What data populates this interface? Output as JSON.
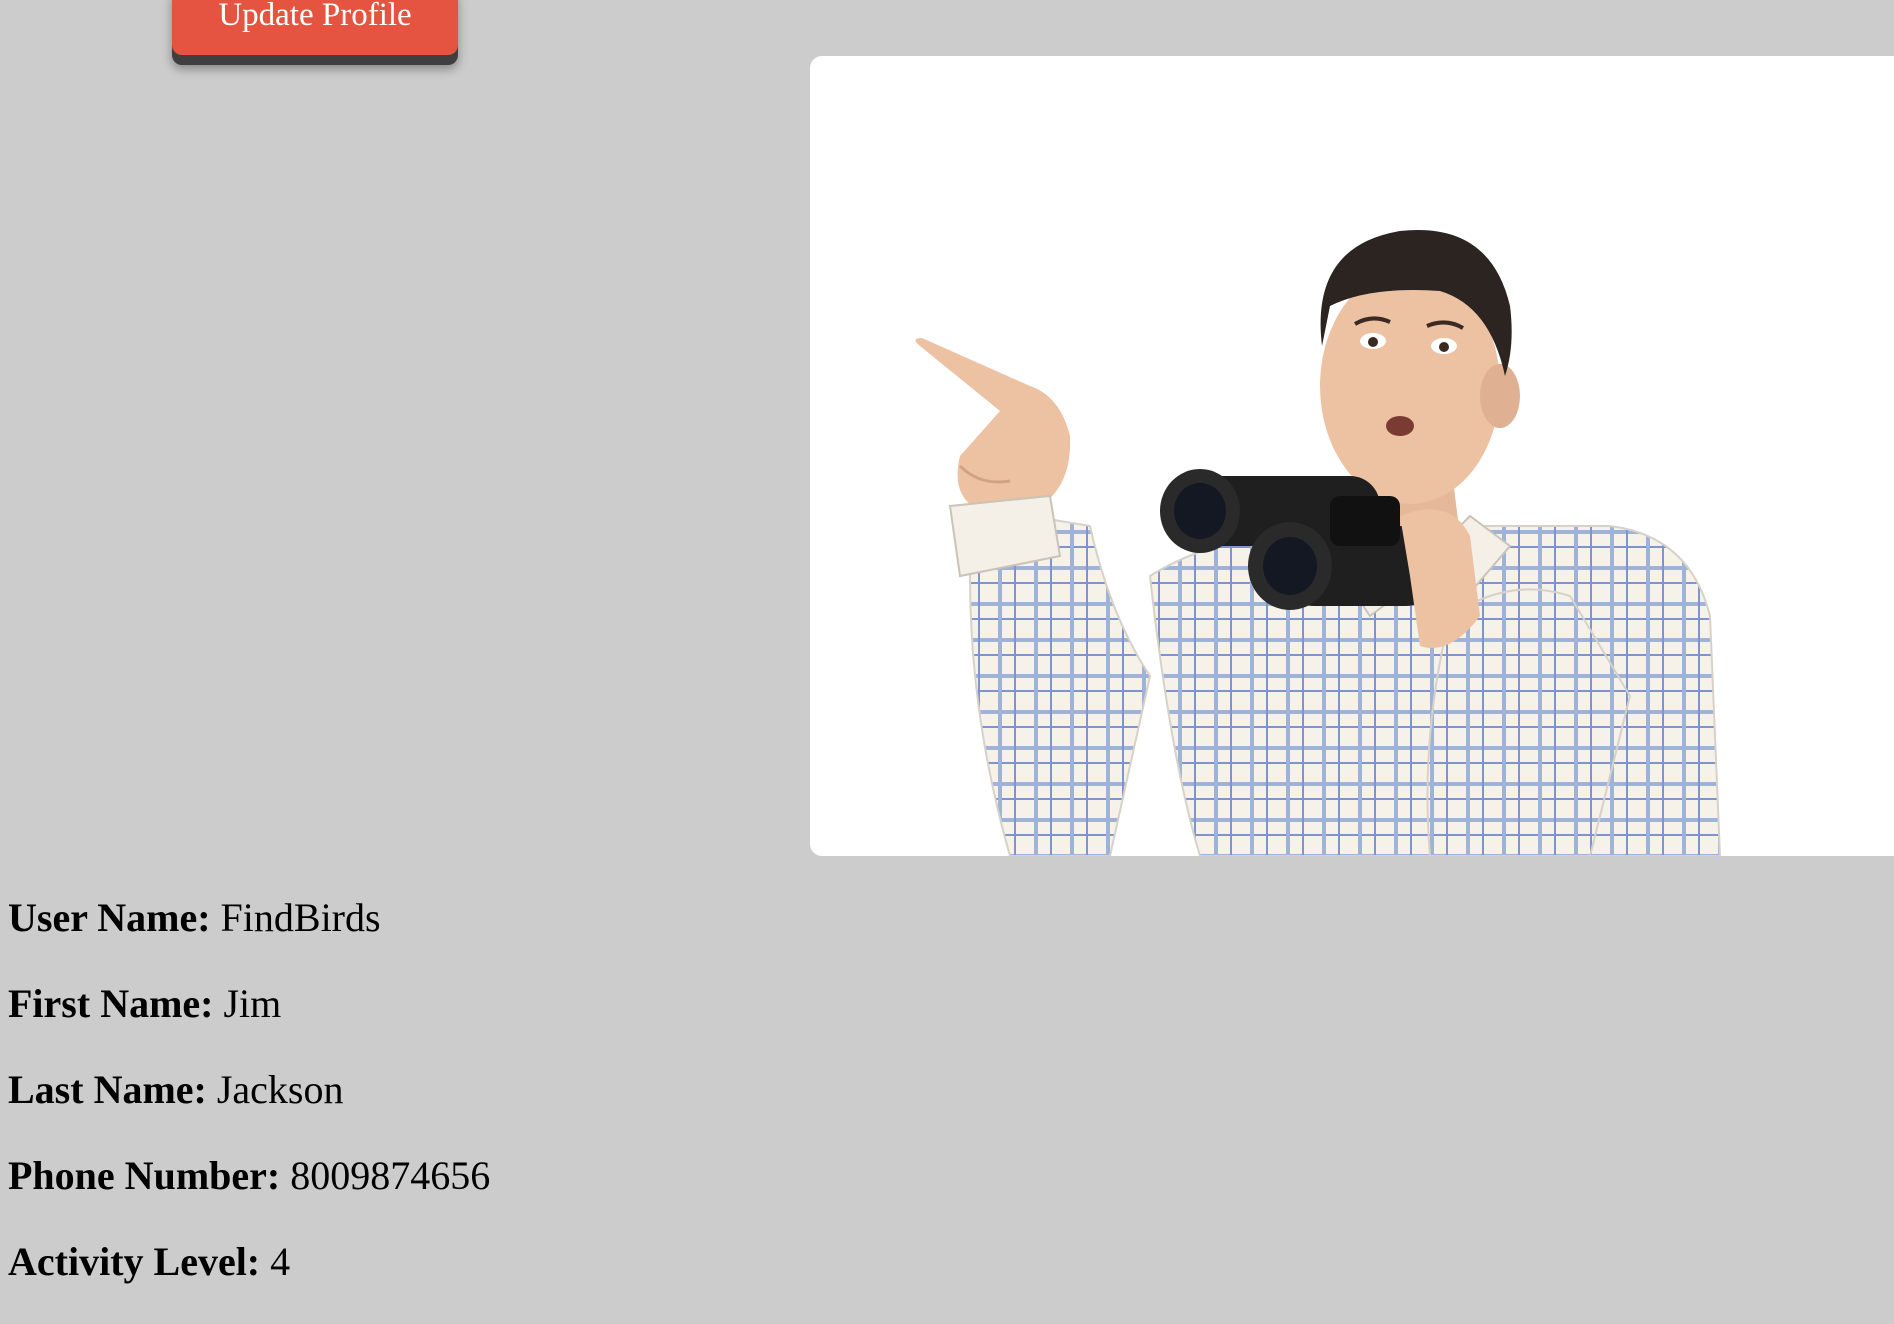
{
  "actions": {
    "update_profile_label": "Update Profile"
  },
  "colors": {
    "background": "#cccccc",
    "button": "#e55441",
    "button_shadow": "#3f3f3f",
    "card": "#ffffff"
  },
  "photo": {
    "subject": "man-with-binoculars-pointing"
  },
  "profile": {
    "user_name_label": "User Name:",
    "user_name": "FindBirds",
    "first_name_label": "First Name:",
    "first_name": "Jim",
    "last_name_label": "Last Name:",
    "last_name": "Jackson",
    "phone_label": "Phone Number:",
    "phone": "8009874656",
    "activity_label": "Activity Level:",
    "activity": "4"
  }
}
